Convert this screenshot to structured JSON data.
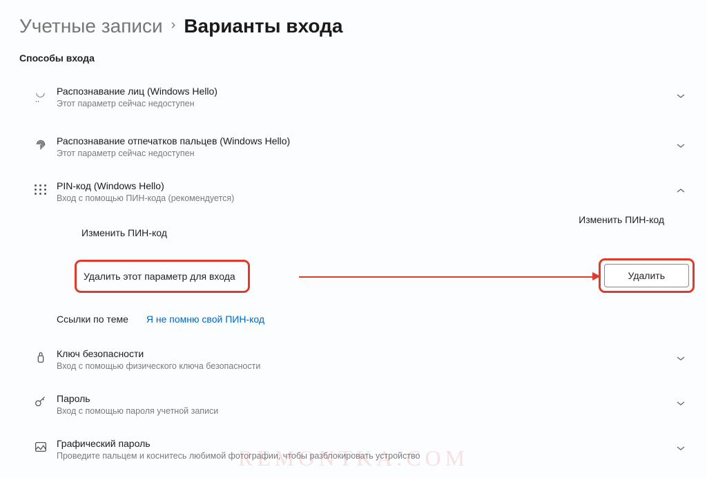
{
  "breadcrumb": {
    "parent": "Учетные записи",
    "current": "Варианты входа"
  },
  "section_label": "Способы входа",
  "options": {
    "face": {
      "title": "Распознавание лиц (Windows Hello)",
      "sub": "Этот параметр сейчас недоступен"
    },
    "finger": {
      "title": "Распознавание отпечатков пальцев (Windows Hello)",
      "sub": "Этот параметр сейчас недоступен"
    },
    "pin": {
      "title": "PIN-код (Windows Hello)",
      "sub": "Вход с помощью ПИН-кода (рекомендуется)",
      "change_left": "Изменить ПИН-код",
      "change_right": "Изменить ПИН-код",
      "remove_label": "Удалить этот параметр для входа",
      "remove_btn": "Удалить"
    },
    "key": {
      "title": "Ключ безопасности",
      "sub": "Вход с помощью физического ключа безопасности"
    },
    "pwd": {
      "title": "Пароль",
      "sub": "Вход с помощью пароля учетной записи"
    },
    "pic": {
      "title": "Графический пароль",
      "sub": "Проведите пальцем и коснитесь любимой фотографии, чтобы разблокировать устройство"
    }
  },
  "links": {
    "label": "Ссылки по теме",
    "forgot": "Я не помню свой ПИН-код"
  },
  "watermark": "REMONTKA.COM"
}
